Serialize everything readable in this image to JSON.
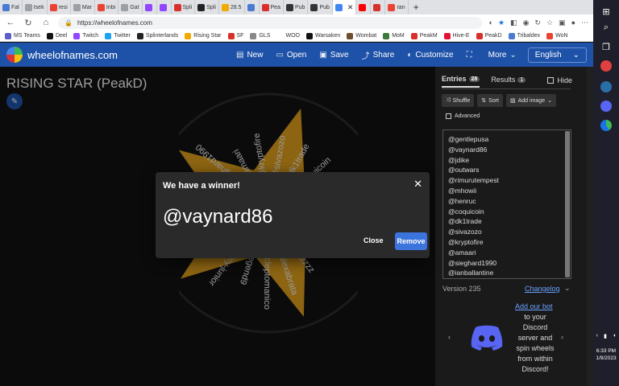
{
  "browser": {
    "tabs": [
      {
        "label": "Fal",
        "color": "#4a7bd0"
      },
      {
        "label": "Isek",
        "color": "#9aa0a6"
      },
      {
        "label": "resi",
        "color": "#ea4335"
      },
      {
        "label": "Mar",
        "color": "#9aa0a6"
      },
      {
        "label": "Inbi",
        "color": "#ea4335"
      },
      {
        "label": "Gat",
        "color": "#9aa0a6"
      },
      {
        "label": "",
        "color": "#9146ff"
      },
      {
        "label": "",
        "color": "#9146ff"
      },
      {
        "label": "Spli",
        "color": "#d9302c"
      },
      {
        "label": "Spli",
        "color": "#222222"
      },
      {
        "label": "28.5",
        "color": "#f2a900"
      },
      {
        "label": "",
        "color": "#4a7bd0"
      },
      {
        "label": "Pea",
        "color": "#d9302c"
      },
      {
        "label": "Pub",
        "color": "#333333"
      },
      {
        "label": "Pub",
        "color": "#333333"
      },
      {
        "label": "",
        "color": "#4285f4",
        "active": true
      },
      {
        "label": "",
        "color": "#ff0000"
      },
      {
        "label": "",
        "color": "#d9302c"
      },
      {
        "label": "ran",
        "color": "#ea4335"
      }
    ],
    "new_tab": "+",
    "url": "https://wheelofnames.com",
    "bookmarks": [
      {
        "label": "MS Teams",
        "color": "#5b5fc7"
      },
      {
        "label": "Deel",
        "color": "#111111"
      },
      {
        "label": "Twitch",
        "color": "#9146ff"
      },
      {
        "label": "Twitter",
        "color": "#1da1f2"
      },
      {
        "label": "Splinterlands",
        "color": "#222222"
      },
      {
        "label": "Rising Star",
        "color": "#f2a900"
      },
      {
        "label": "SF",
        "color": "#d9302c"
      },
      {
        "label": "GLS",
        "color": "#888888"
      },
      {
        "label": "WOO",
        "color": "#ffffff"
      },
      {
        "label": "Warsaken",
        "color": "#111111"
      },
      {
        "label": "Wombat",
        "color": "#6b4e2e"
      },
      {
        "label": "MoM",
        "color": "#3a7a3a"
      },
      {
        "label": "PeakM",
        "color": "#d9302c"
      },
      {
        "label": "Hive-E",
        "color": "#e31337"
      },
      {
        "label": "PeakD",
        "color": "#d9302c"
      },
      {
        "label": "Tribaldex",
        "color": "#4a7bd0"
      },
      {
        "label": "WoN",
        "color": "#ea4335"
      }
    ]
  },
  "app": {
    "brand": "wheelofnames.com",
    "menu": [
      {
        "label": "New",
        "icon": "file-icon"
      },
      {
        "label": "Open",
        "icon": "folder-icon"
      },
      {
        "label": "Save",
        "icon": "save-icon"
      },
      {
        "label": "Share",
        "icon": "share-icon"
      },
      {
        "label": "Customize",
        "icon": "palette-icon"
      },
      {
        "label": "",
        "icon": "fullscreen-icon"
      },
      {
        "label": "More",
        "icon": "chevron-down-icon"
      }
    ],
    "language": "English"
  },
  "wheel": {
    "title": "RISING STAR (PeakD)",
    "slice_labels": [
      "@sivazozo",
      "@dk1trade",
      "@coquicoin",
      "@henruc",
      "@mhowii",
      "@rimurutempest",
      "@olaf.gui",
      "@blitzzzz",
      "@alexabrata",
      "@cleptomanico",
      "@legend9",
      "@jimmy-junior",
      "@ebgg003",
      "@bodearong",
      "@bbcesinus",
      "@ianballantine",
      "@sieghard1990",
      "@amaari",
      "@kryptofire"
    ],
    "colors": {
      "dark": "#121212",
      "gold": "#d89a1c",
      "rim": "#2a2a2a"
    }
  },
  "dialog": {
    "title": "We have a winner!",
    "winner": "@vaynard86",
    "close_label": "Close",
    "remove_label": "Remove"
  },
  "sidebar": {
    "entries_tab": "Entries",
    "entries_count": "28",
    "results_tab": "Results",
    "results_count": "1",
    "hide_label": "Hide",
    "shuffle_label": "Shuffle",
    "sort_label": "Sort",
    "add_image_label": "Add image",
    "advanced_label": "Advanced",
    "entries": [
      "@gentlepusa",
      "@vaynard86",
      "@jdike",
      "@outwars",
      "@rimurutempest",
      "@mhowii",
      "@henruc",
      "@coquicoin",
      "@dk1trade",
      "@sivazozo",
      "@kryptofire",
      "@amaari",
      "@sieghard1990",
      "@ianballantine"
    ],
    "version": "Version 235",
    "changelog": "Changelog",
    "promo_link": "Add our bot",
    "promo_lines": [
      "to your",
      "Discord",
      "server and",
      "spin wheels",
      "from within",
      "Discord!"
    ]
  },
  "taskbar": {
    "time": "6:33 PM",
    "date": "1/9/2023"
  }
}
